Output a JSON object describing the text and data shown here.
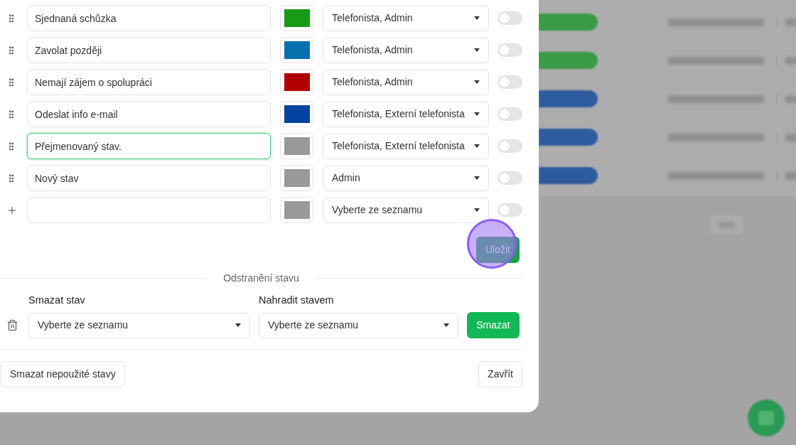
{
  "statuses": [
    {
      "kind": "existing",
      "name": "Sjednaná schůzka",
      "focused": false,
      "color": "#179b17",
      "roles": "Telefonista, Admin",
      "on": false
    },
    {
      "kind": "existing",
      "name": "Zavolat později",
      "focused": false,
      "color": "#0572ae",
      "roles": "Telefonista, Admin",
      "on": false
    },
    {
      "kind": "existing",
      "name": "Nemají zájem o spolupráci",
      "focused": false,
      "color": "#b10000",
      "roles": "Telefonista, Admin",
      "on": false
    },
    {
      "kind": "existing",
      "name": "Odeslat info e-mail",
      "focused": false,
      "color": "#0343a0",
      "roles": "Telefonista, Externí telefonista",
      "on": false
    },
    {
      "kind": "existing",
      "name": "Přejmenovaný stav.",
      "focused": true,
      "color": "#999999",
      "roles": "Telefonista, Externí telefonista",
      "on": false
    },
    {
      "kind": "existing",
      "name": "Nový stav",
      "focused": false,
      "color": "#999999",
      "roles": "Admin",
      "on": false
    },
    {
      "kind": "new",
      "focused": false,
      "color": "#999999",
      "placeholder": "Vyberte ze seznamu",
      "on": false
    }
  ],
  "save_button": "Uložit",
  "removal": {
    "title": "Odstranění stavu",
    "delete_label": "Smazat stav",
    "delete_select": {
      "placeholder": "Vyberte ze seznamu"
    },
    "replace_label": "Nahradit stavem",
    "replace_select": {
      "placeholder": "Vyberte ze seznamu"
    },
    "button": "Smazat"
  },
  "footer": {
    "left_button": "Smazat nepoužité stavy",
    "right_button": "Zavřít"
  },
  "background": {
    "rows": [
      {
        "color": "#3a9a46"
      },
      {
        "color": "#3a9a46"
      },
      {
        "color": "#2e5b9e"
      },
      {
        "color": "#2e5b9e"
      },
      {
        "color": "#2e5b9e"
      }
    ]
  }
}
